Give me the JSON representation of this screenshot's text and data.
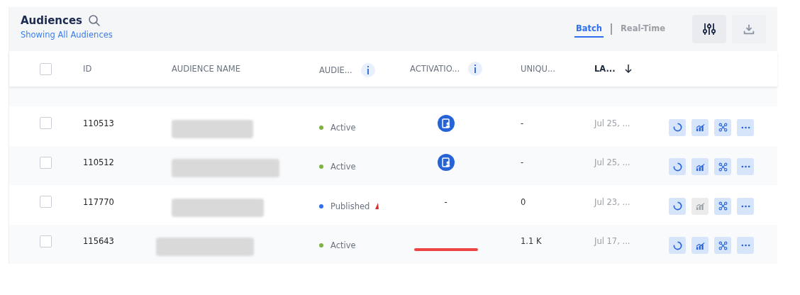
{
  "header": {
    "title": "Audiences",
    "subtitle": "Showing All Audiences",
    "modes": [
      {
        "label": "Batch",
        "selected": true
      },
      {
        "label": "Real-Time",
        "selected": false
      }
    ]
  },
  "table": {
    "select_all": {
      "checked": false
    },
    "columns": [
      {
        "label": "ID",
        "info": false,
        "sort": false
      },
      {
        "label": "AUDIENCE NAME",
        "info": false,
        "sort": false
      },
      {
        "label": "AUDIE...",
        "info": true,
        "sort": false
      },
      {
        "label": "ACTIVATIO...",
        "info": true,
        "sort": false
      },
      {
        "label": "UNIQU...",
        "info": false,
        "sort": false
      },
      {
        "label": "LA...",
        "info": false,
        "sort": true
      }
    ],
    "rows": [
      {
        "id": "110513",
        "checked": false,
        "status": "Active",
        "color": "#7cb342",
        "flag": false,
        "activation": {
          "kind": "icon"
        },
        "unique": "-",
        "last": "Jul 25, ...",
        "chart_disabled": false
      },
      {
        "id": "110512",
        "checked": false,
        "status": "Active",
        "color": "#7cb342",
        "flag": false,
        "activation": {
          "kind": "icon"
        },
        "unique": "-",
        "last": "Jul 25, ...",
        "chart_disabled": false
      },
      {
        "id": "117770",
        "checked": false,
        "status": "Published",
        "color": "#2f6fed",
        "flag": true,
        "activation": {
          "kind": "text",
          "text": "-"
        },
        "unique": "0",
        "last": "Jul 23, ...",
        "chart_disabled": true
      },
      {
        "id": "115643",
        "checked": false,
        "status": "Active",
        "color": "#7cb342",
        "flag": false,
        "activation": {
          "kind": "bar"
        },
        "unique": "1.1 K",
        "last": "Jul 17, ...",
        "chart_disabled": false
      }
    ]
  }
}
